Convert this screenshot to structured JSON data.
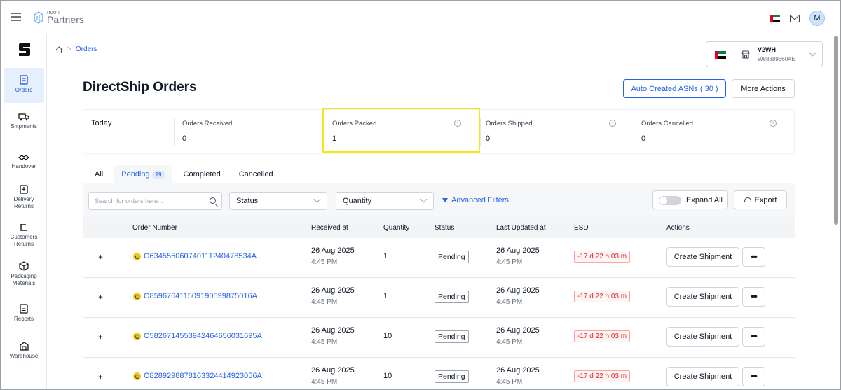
{
  "topbar": {
    "logo_small": "noon",
    "logo_big": "Partners",
    "avatar_initial": "M"
  },
  "sidebar": {
    "items": [
      {
        "label": "Orders",
        "icon": "clipboard-icon",
        "active": true
      },
      {
        "label": "Shipments",
        "icon": "truck-icon"
      },
      {
        "label": "Handover",
        "icon": "handshake-icon"
      },
      {
        "label": "Delivery Returns",
        "icon": "box-down-icon"
      },
      {
        "label": "Customers Returns",
        "icon": "return-arrow-icon"
      },
      {
        "label": "Packaging Meterials",
        "icon": "package-icon"
      },
      {
        "label": "Reports",
        "icon": "report-icon"
      },
      {
        "label": "Warehouse",
        "icon": "warehouse-icon"
      }
    ]
  },
  "breadcrumb": {
    "current": "Orders"
  },
  "store": {
    "name": "V2WH",
    "id": "W88889660AE"
  },
  "page": {
    "title": "DirectShip Orders",
    "asn_button": "Auto Created ASNs ( 30 )",
    "more_actions": "More Actions"
  },
  "stats": {
    "today_label": "Today",
    "items": [
      {
        "label": "Orders Received",
        "value": "0"
      },
      {
        "label": "Orders Packed",
        "value": "1"
      },
      {
        "label": "Orders Shipped",
        "value": "0"
      },
      {
        "label": "Orders Cancelled",
        "value": "0"
      }
    ]
  },
  "tabs": [
    {
      "label": "All"
    },
    {
      "label": "Pending",
      "count": "19",
      "active": true
    },
    {
      "label": "Completed"
    },
    {
      "label": "Cancelled"
    }
  ],
  "filters": {
    "search_placeholder": "Search for orders here...",
    "status": "Status",
    "quantity": "Quantity",
    "advanced": "Advanced Filters",
    "expand_all": "Expand All",
    "export": "Export"
  },
  "table": {
    "headers": [
      "Order Number",
      "Received at",
      "Quantity",
      "Status",
      "Last Updated at",
      "ESD",
      "Actions"
    ],
    "rows": [
      {
        "order": "O634555060740111240478534A",
        "received_date": "26 Aug 2025",
        "received_time": "4:45 PM",
        "quantity": "1",
        "status": "Pending",
        "updated_date": "26 Aug 2025",
        "updated_time": "4:45 PM",
        "esd": "-17 d 22 h 03 m",
        "action": "Create Shipment"
      },
      {
        "order": "O859676411509190599875016A",
        "received_date": "26 Aug 2025",
        "received_time": "4:45 PM",
        "quantity": "1",
        "status": "Pending",
        "updated_date": "26 Aug 2025",
        "updated_time": "4:45 PM",
        "esd": "-17 d 22 h 03 m",
        "action": "Create Shipment"
      },
      {
        "order": "O582671455394246465603169 5A",
        "received_date": "26 Aug 2025",
        "received_time": "4:45 PM",
        "quantity": "10",
        "status": "Pending",
        "updated_date": "26 Aug 2025",
        "updated_time": "4:45 PM",
        "esd": "-17 d 22 h 03 m",
        "action": "Create Shipment"
      },
      {
        "order": "O828929887816332441492305 6A",
        "received_date": "26 Aug 2025",
        "received_time": "4:45 PM",
        "quantity": "10",
        "status": "Pending",
        "updated_date": "26 Aug 2025",
        "updated_time": "4:45 PM",
        "esd": "-17 d 22 h 03 m",
        "action": "Create Shipment"
      }
    ]
  },
  "colors": {
    "accent": "#2563eb",
    "highlight": "#f5e61a",
    "esd_red": "#dc2626"
  }
}
